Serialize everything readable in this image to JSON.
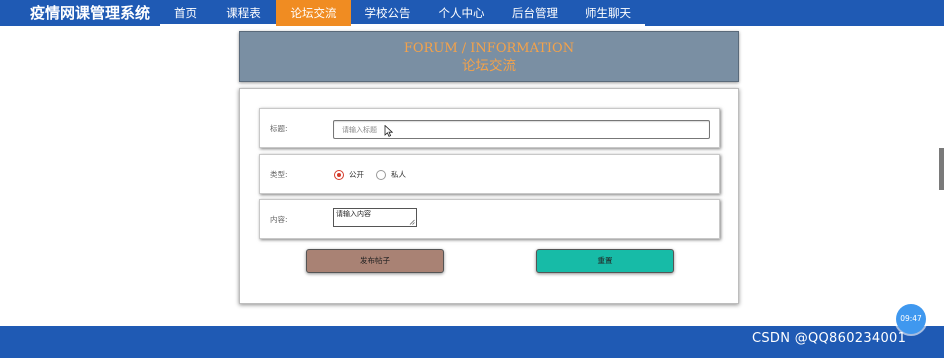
{
  "app": {
    "title": "疫情网课管理系统"
  },
  "nav": {
    "items": [
      {
        "label": "首页"
      },
      {
        "label": "课程表"
      },
      {
        "label": "论坛交流",
        "active": true
      },
      {
        "label": "学校公告"
      },
      {
        "label": "个人中心"
      },
      {
        "label": "后台管理"
      },
      {
        "label": "师生聊天"
      }
    ]
  },
  "banner": {
    "title_en": "FORUM / INFORMATION",
    "title_cn": "论坛交流"
  },
  "form": {
    "title_label": "标题:",
    "title_placeholder": "请输入标题",
    "type_label": "类型:",
    "type_options": [
      {
        "label": "公开",
        "checked": true
      },
      {
        "label": "私人",
        "checked": false
      }
    ],
    "content_label": "内容:",
    "content_placeholder": "请输入内容",
    "submit_label": "发布帖子",
    "reset_label": "重置"
  },
  "overlay": {
    "clock_time": "09:47",
    "watermark": "CSDN @QQ860234001"
  },
  "colors": {
    "nav_bg": "#1f5ab4",
    "nav_active": "#f08c22",
    "banner_bg": "#7a8fa3",
    "banner_text": "#f4a24a",
    "submit_btn": "#a98274",
    "reset_btn": "#17bba7",
    "radio_checked": "#d53a2a"
  },
  "icons": {
    "cursor": "mouse-pointer-icon",
    "resize": "resize-handle-icon"
  }
}
